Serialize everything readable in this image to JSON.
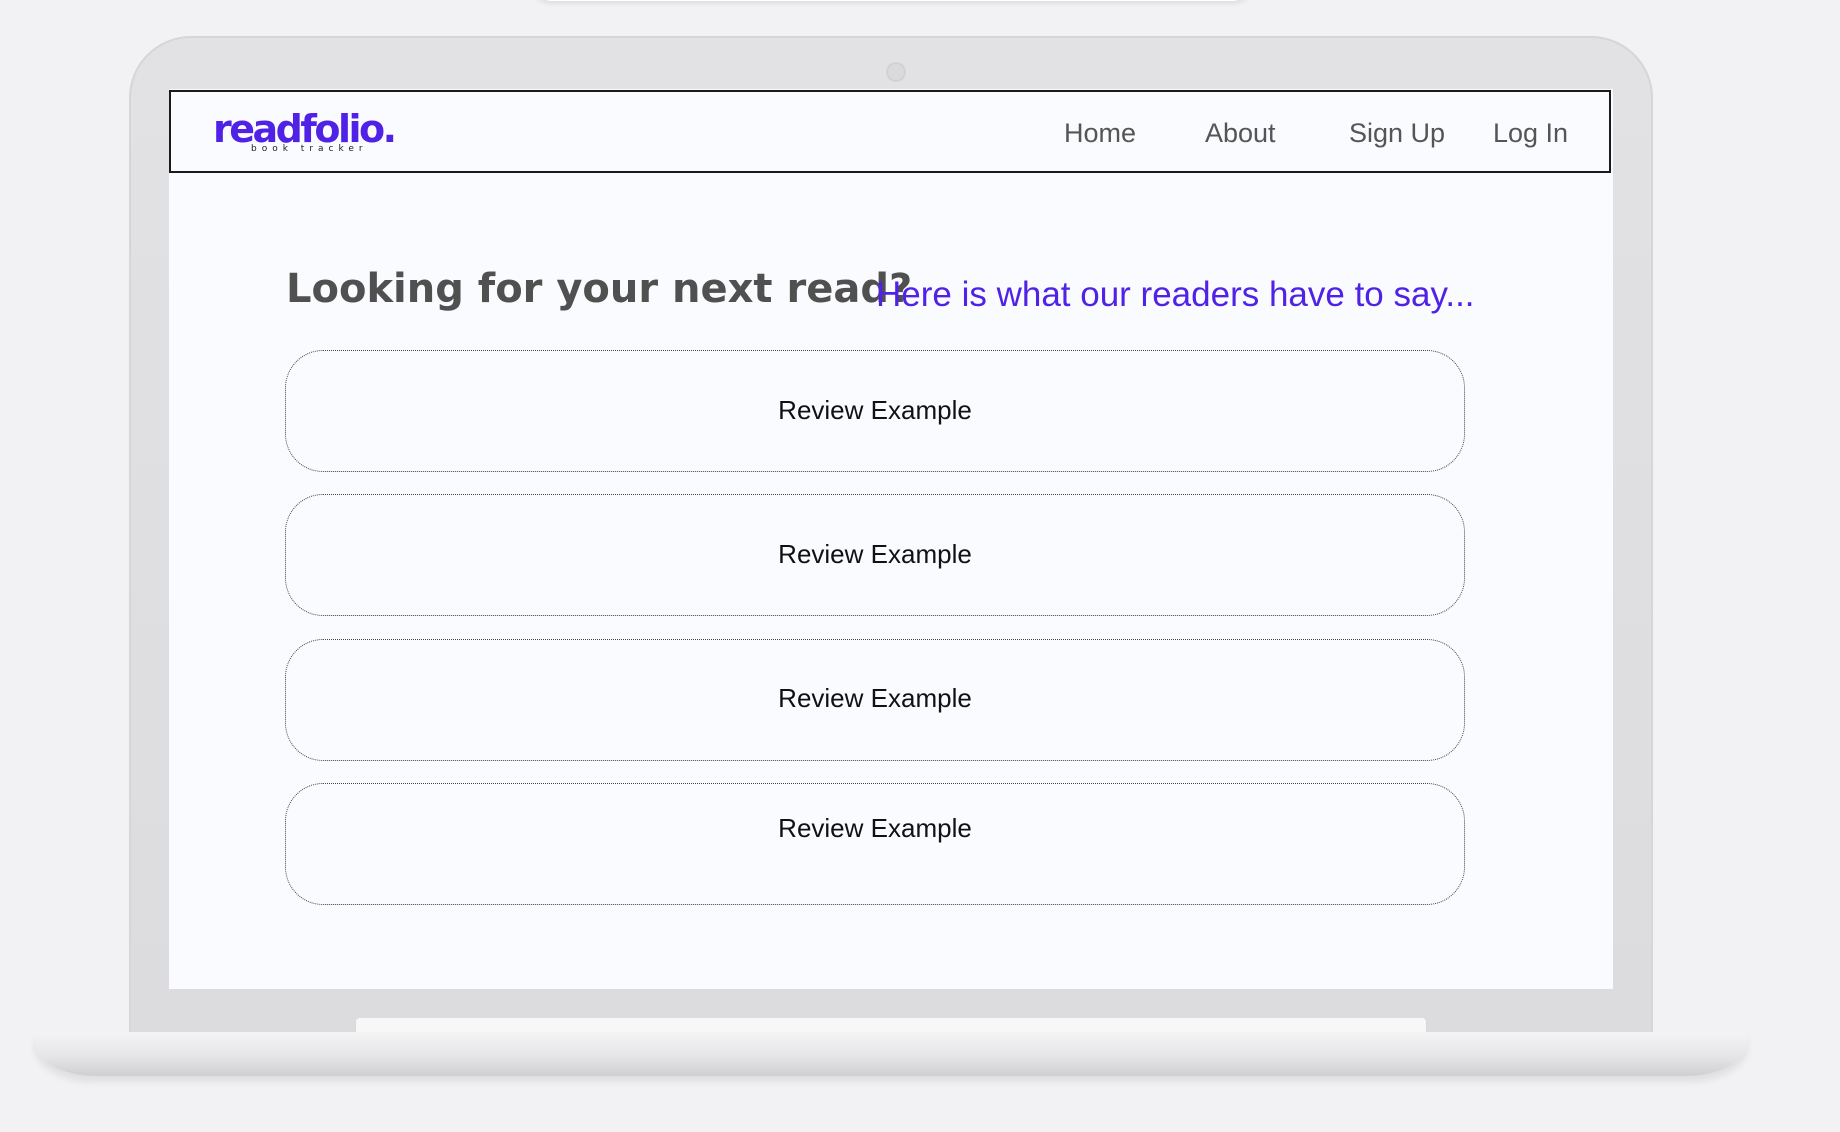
{
  "brand": {
    "name": "readfolio.",
    "tagline": "book tracker",
    "accent_color": "#4f22e6"
  },
  "nav": {
    "items": [
      {
        "label": "Home"
      },
      {
        "label": "About"
      },
      {
        "label": "Sign Up"
      },
      {
        "label": "Log In"
      }
    ]
  },
  "main": {
    "heading": "Looking for your next read?",
    "subheading": "Here is what our readers have to say...",
    "reviews": [
      {
        "title": "Review Example"
      },
      {
        "title": "Review Example"
      },
      {
        "title": "Review Example"
      },
      {
        "title": "Review Example"
      }
    ]
  }
}
